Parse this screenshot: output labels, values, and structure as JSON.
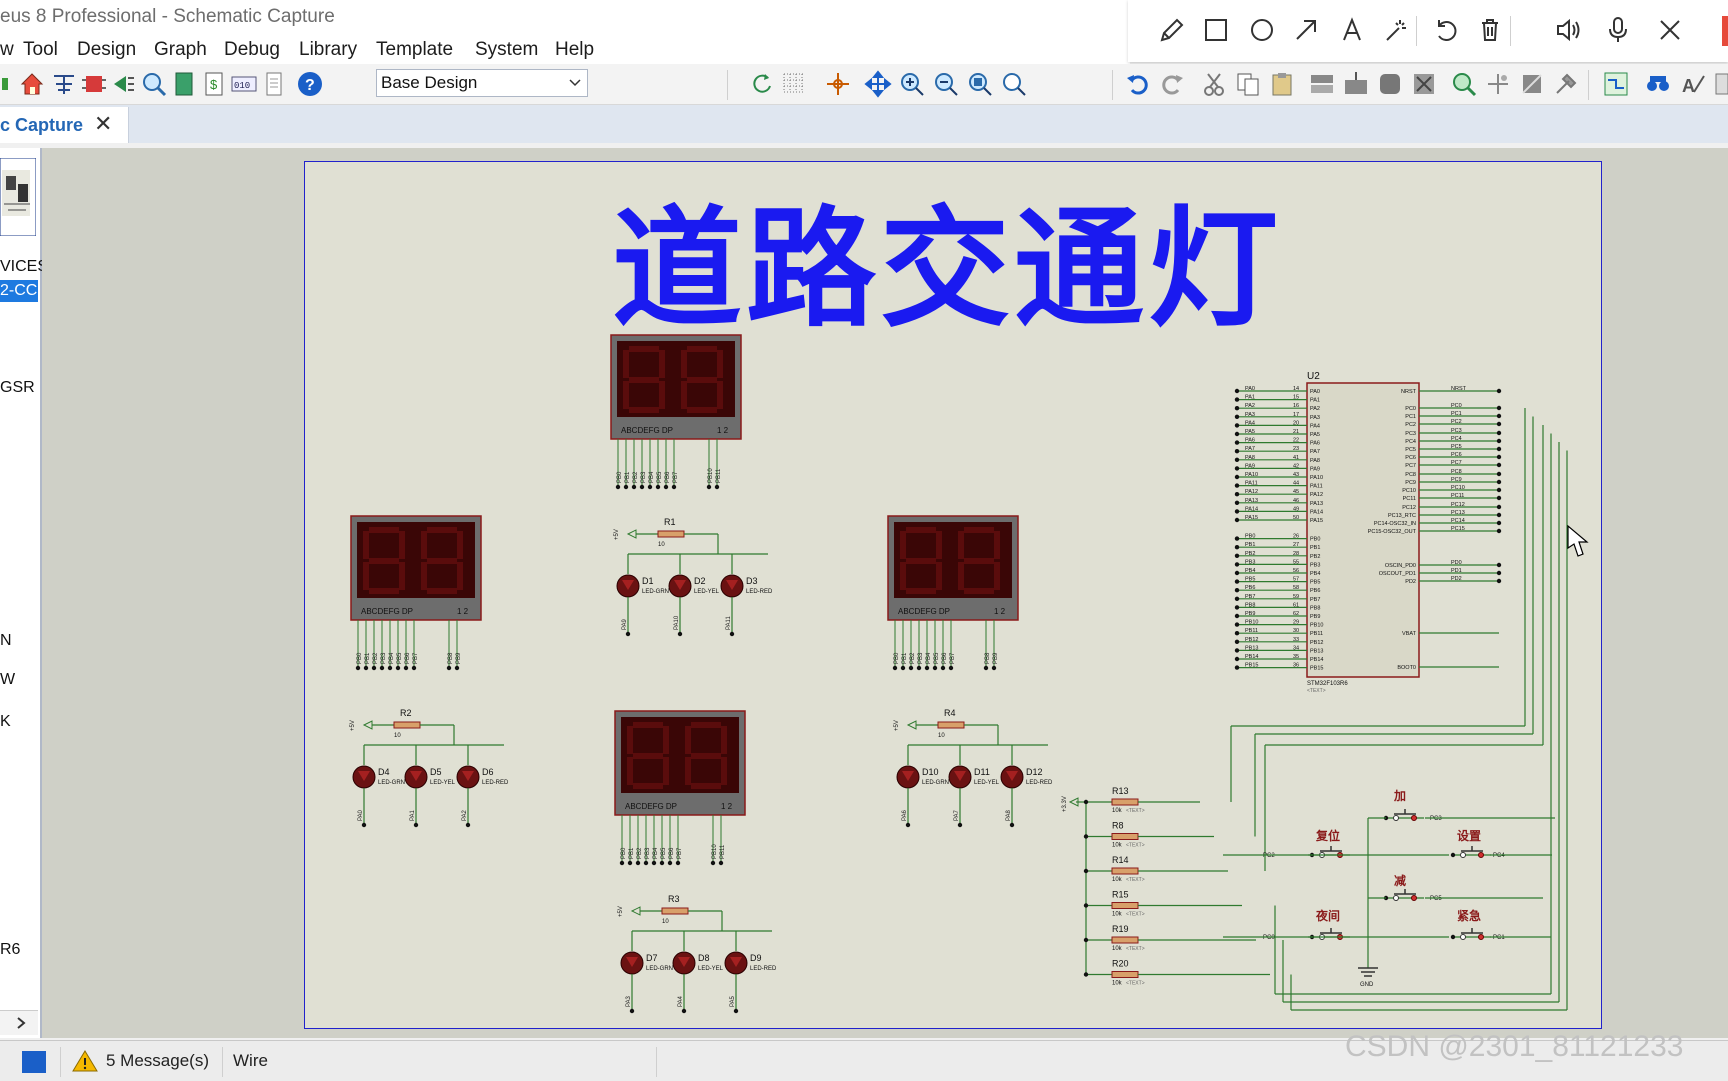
{
  "window": {
    "title": "eus 8 Professional - Schematic Capture"
  },
  "menu": [
    "w",
    "Tool",
    "Design",
    "Graph",
    "Debug",
    "Library",
    "Template",
    "System",
    "Help"
  ],
  "toolbar": {
    "variant_select": "Base Design"
  },
  "tab": {
    "label": "c Capture",
    "close": "✕"
  },
  "left_panel": {
    "header": "VICES",
    "selected": "2-CC",
    "items": [
      "GSR",
      "N",
      "W",
      "K",
      "R6"
    ]
  },
  "schematic": {
    "title": "道路交通灯",
    "mcu": {
      "ref": "U2",
      "part": "STM32F103R6",
      "text": "<TEXT>",
      "left_pins": [
        "PA0",
        "PA1",
        "PA2",
        "PA3",
        "PA4",
        "PA5",
        "PA6",
        "PA7",
        "PA8",
        "PA9",
        "PA10",
        "PA11",
        "PA12",
        "PA13",
        "PA14",
        "PA15",
        "PB0",
        "PB1",
        "PB2",
        "PB3",
        "PB4",
        "PB5",
        "PB6",
        "PB7",
        "PB8",
        "PB9",
        "PB10",
        "PB11",
        "PB12",
        "PB13",
        "PB14",
        "PB15"
      ],
      "left_pin_numbers": [
        "14",
        "15",
        "16",
        "17",
        "20",
        "21",
        "22",
        "23",
        "41",
        "42",
        "43",
        "44",
        "45",
        "46",
        "49",
        "50",
        "26",
        "27",
        "28",
        "55",
        "56",
        "57",
        "58",
        "59",
        "61",
        "62",
        "29",
        "30",
        "33",
        "34",
        "35",
        "36"
      ],
      "right_pins": [
        "NRST",
        "PC0",
        "PC1",
        "PC2",
        "PC3",
        "PC4",
        "PC5",
        "PC6",
        "PC7",
        "PC8",
        "PC9",
        "PC10",
        "PC11",
        "PC12",
        "PC13_RTC",
        "PC14-OSC32_IN",
        "PC15-OSC32_OUT",
        "OSCIN_PD0",
        "OSCOUT_PD1",
        "PD2",
        "VBAT",
        "BOOT0"
      ],
      "right_nets": [
        "NRST",
        "PC0",
        "PC1",
        "PC2",
        "PC3",
        "PC4",
        "PC5",
        "PC6",
        "PC7",
        "PC8",
        "PC9",
        "PC10",
        "PC11",
        "PC12",
        "PC13",
        "PC14",
        "PC15",
        "PD0",
        "PD1",
        "PD2",
        "",
        ""
      ]
    },
    "displays": [
      {
        "name": "top",
        "segments": "ABCDEFG DP",
        "digits": "1 2",
        "pins": [
          "PB0",
          "PB1",
          "PB2",
          "PB3",
          "PB4",
          "PB5",
          "PB6",
          "PB7",
          "PB10",
          "PB11"
        ]
      },
      {
        "name": "left",
        "segments": "ABCDEFG DP",
        "digits": "1 2",
        "pins": [
          "PB0",
          "PB1",
          "PB2",
          "PB3",
          "PB4",
          "PB5",
          "PB6",
          "PB7",
          "PB8",
          "PB9"
        ]
      },
      {
        "name": "right",
        "segments": "ABCDEFG DP",
        "digits": "1 2",
        "pins": [
          "PB0",
          "PB1",
          "PB2",
          "PB3",
          "PB4",
          "PB5",
          "PB6",
          "PB7",
          "PB8",
          "PB9"
        ]
      },
      {
        "name": "bottom",
        "segments": "ABCDEFG DP",
        "digits": "1 2",
        "pins": [
          "PB0",
          "PB1",
          "PB2",
          "PB3",
          "PB4",
          "PB5",
          "PB6",
          "PB7",
          "PB10",
          "PB11"
        ]
      }
    ],
    "led_groups": [
      {
        "res": "R1",
        "val": "10",
        "leds": [
          [
            "D1",
            "LED-GRN",
            "PA9"
          ],
          [
            "D2",
            "LED-YEL",
            "PA10"
          ],
          [
            "D3",
            "LED-RED",
            "PA11"
          ]
        ]
      },
      {
        "res": "R2",
        "val": "10",
        "leds": [
          [
            "D4",
            "LED-GRN",
            "PA0"
          ],
          [
            "D5",
            "LED-YEL",
            "PA1"
          ],
          [
            "D6",
            "LED-RED",
            "PA2"
          ]
        ]
      },
      {
        "res": "R4",
        "val": "10",
        "leds": [
          [
            "D10",
            "LED-GRN",
            "PA6"
          ],
          [
            "D11",
            "LED-YEL",
            "PA7"
          ],
          [
            "D12",
            "LED-RED",
            "PA8"
          ]
        ]
      },
      {
        "res": "R3",
        "val": "10",
        "leds": [
          [
            "D7",
            "LED-GRN",
            "PA3"
          ],
          [
            "D8",
            "LED-YEL",
            "PA4"
          ],
          [
            "D9",
            "LED-RED",
            "PA5"
          ]
        ]
      }
    ],
    "power_label": "+5V",
    "supply_label": "+3.3V",
    "pullups": [
      [
        "R13",
        "10k"
      ],
      [
        "R8",
        "10k"
      ],
      [
        "R14",
        "10k"
      ],
      [
        "R15",
        "10k"
      ],
      [
        "R19",
        "10k"
      ],
      [
        "R20",
        "10k"
      ]
    ],
    "buttons": [
      {
        "label": "加",
        "net": "PC3"
      },
      {
        "label": "复位",
        "net": "PC2"
      },
      {
        "label": "设置",
        "net": "PC4"
      },
      {
        "label": "减",
        "net": "PC5"
      },
      {
        "label": "夜间",
        "net": "PC0"
      },
      {
        "label": "紧急",
        "net": "PC1"
      }
    ],
    "gnd_label": "GND"
  },
  "status": {
    "messages": "5 Message(s)",
    "mode": "Wire"
  },
  "watermark": "CSDN @2301_81121233"
}
